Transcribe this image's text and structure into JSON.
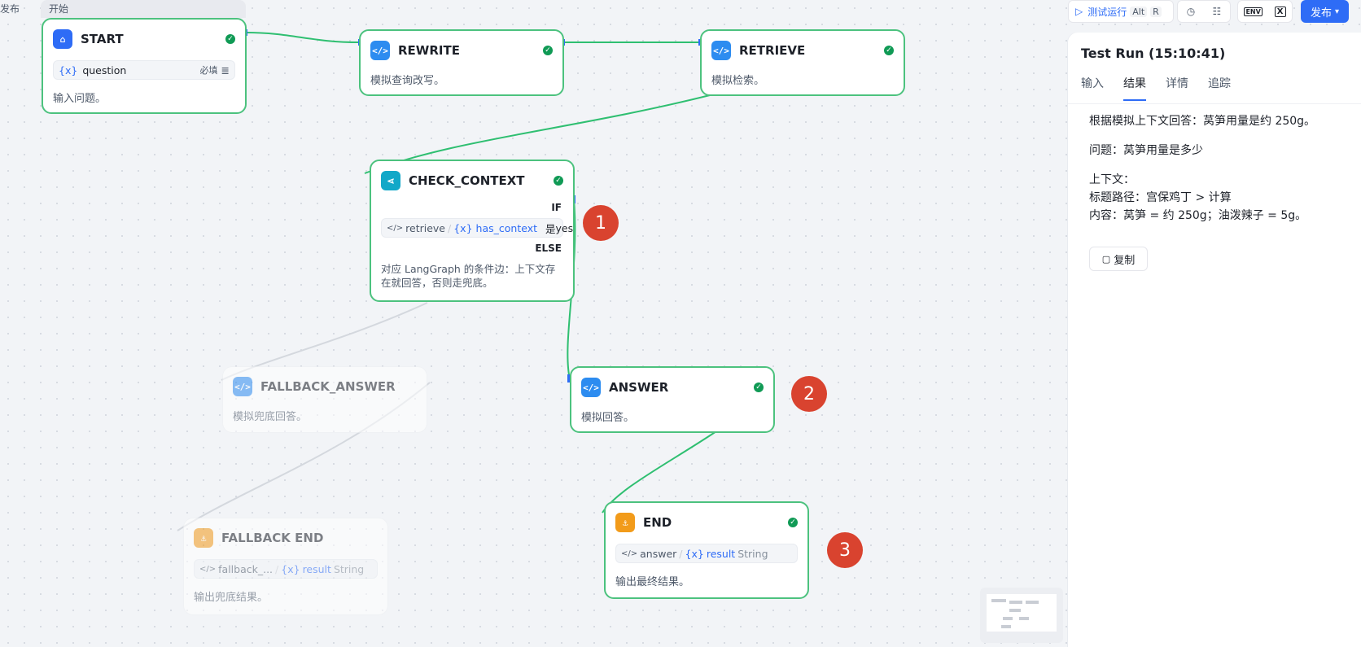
{
  "top_left": {
    "publish_fragment": "发布",
    "group_label": "开始"
  },
  "toolbar": {
    "test_run_label": "测试运行",
    "shortcut_alt": "Alt",
    "shortcut_key": "R",
    "env_label": "ENV",
    "x_label": "X",
    "publish_label": "发布"
  },
  "nodes": {
    "start": {
      "title": "START",
      "var_icon": "{x}",
      "var_name": "question",
      "required": "必填",
      "desc": "输入问题。"
    },
    "rewrite": {
      "title": "REWRITE",
      "desc": "模拟查询改写。"
    },
    "retrieve": {
      "title": "RETRIEVE",
      "desc": "模拟检索。"
    },
    "check_context": {
      "title": "CHECK_CONTEXT",
      "if_label": "IF",
      "cond_source": "retrieve",
      "cond_var": "has_context",
      "cond_op": "是",
      "cond_value": "yes",
      "else_label": "ELSE",
      "desc_line1": "对应 LangGraph 的条件边：上下文存",
      "desc_line2": "在就回答，否则走兜底。"
    },
    "fallback_answer": {
      "title": "FALLBACK_ANSWER",
      "desc": "模拟兜底回答。"
    },
    "answer": {
      "title": "ANSWER",
      "desc": "模拟回答。"
    },
    "end": {
      "title": "END",
      "src": "answer",
      "var": "result",
      "type": "String",
      "desc": "输出最终结果。"
    },
    "fallback_end": {
      "title": "FALLBACK END",
      "src": "fallback_...",
      "var": "result",
      "type": "String",
      "desc": "输出兜底结果。"
    }
  },
  "badges": [
    "1",
    "2",
    "3"
  ],
  "panel": {
    "title": "Test Run (15:10:41)",
    "tabs": [
      "输入",
      "结果",
      "详情",
      "追踪"
    ],
    "active_tab": "结果",
    "result_line1": "根据模拟上下文回答：莴笋用量是约 250g。",
    "result_line2": "问题：莴笋用量是多少",
    "result_line3": "上下文：",
    "result_line4": "标题路径：宫保鸡丁 > 计算",
    "result_line5": "内容：莴笋 = 约 250g；油泼辣子 = 5g。",
    "copy_label": "复制"
  },
  "colors": {
    "edge_active": "#2fbf71",
    "edge_inactive": "#d4d8de",
    "node_border": "#4cc27e",
    "badge": "#d9432f",
    "accent": "#2e6cf6"
  }
}
